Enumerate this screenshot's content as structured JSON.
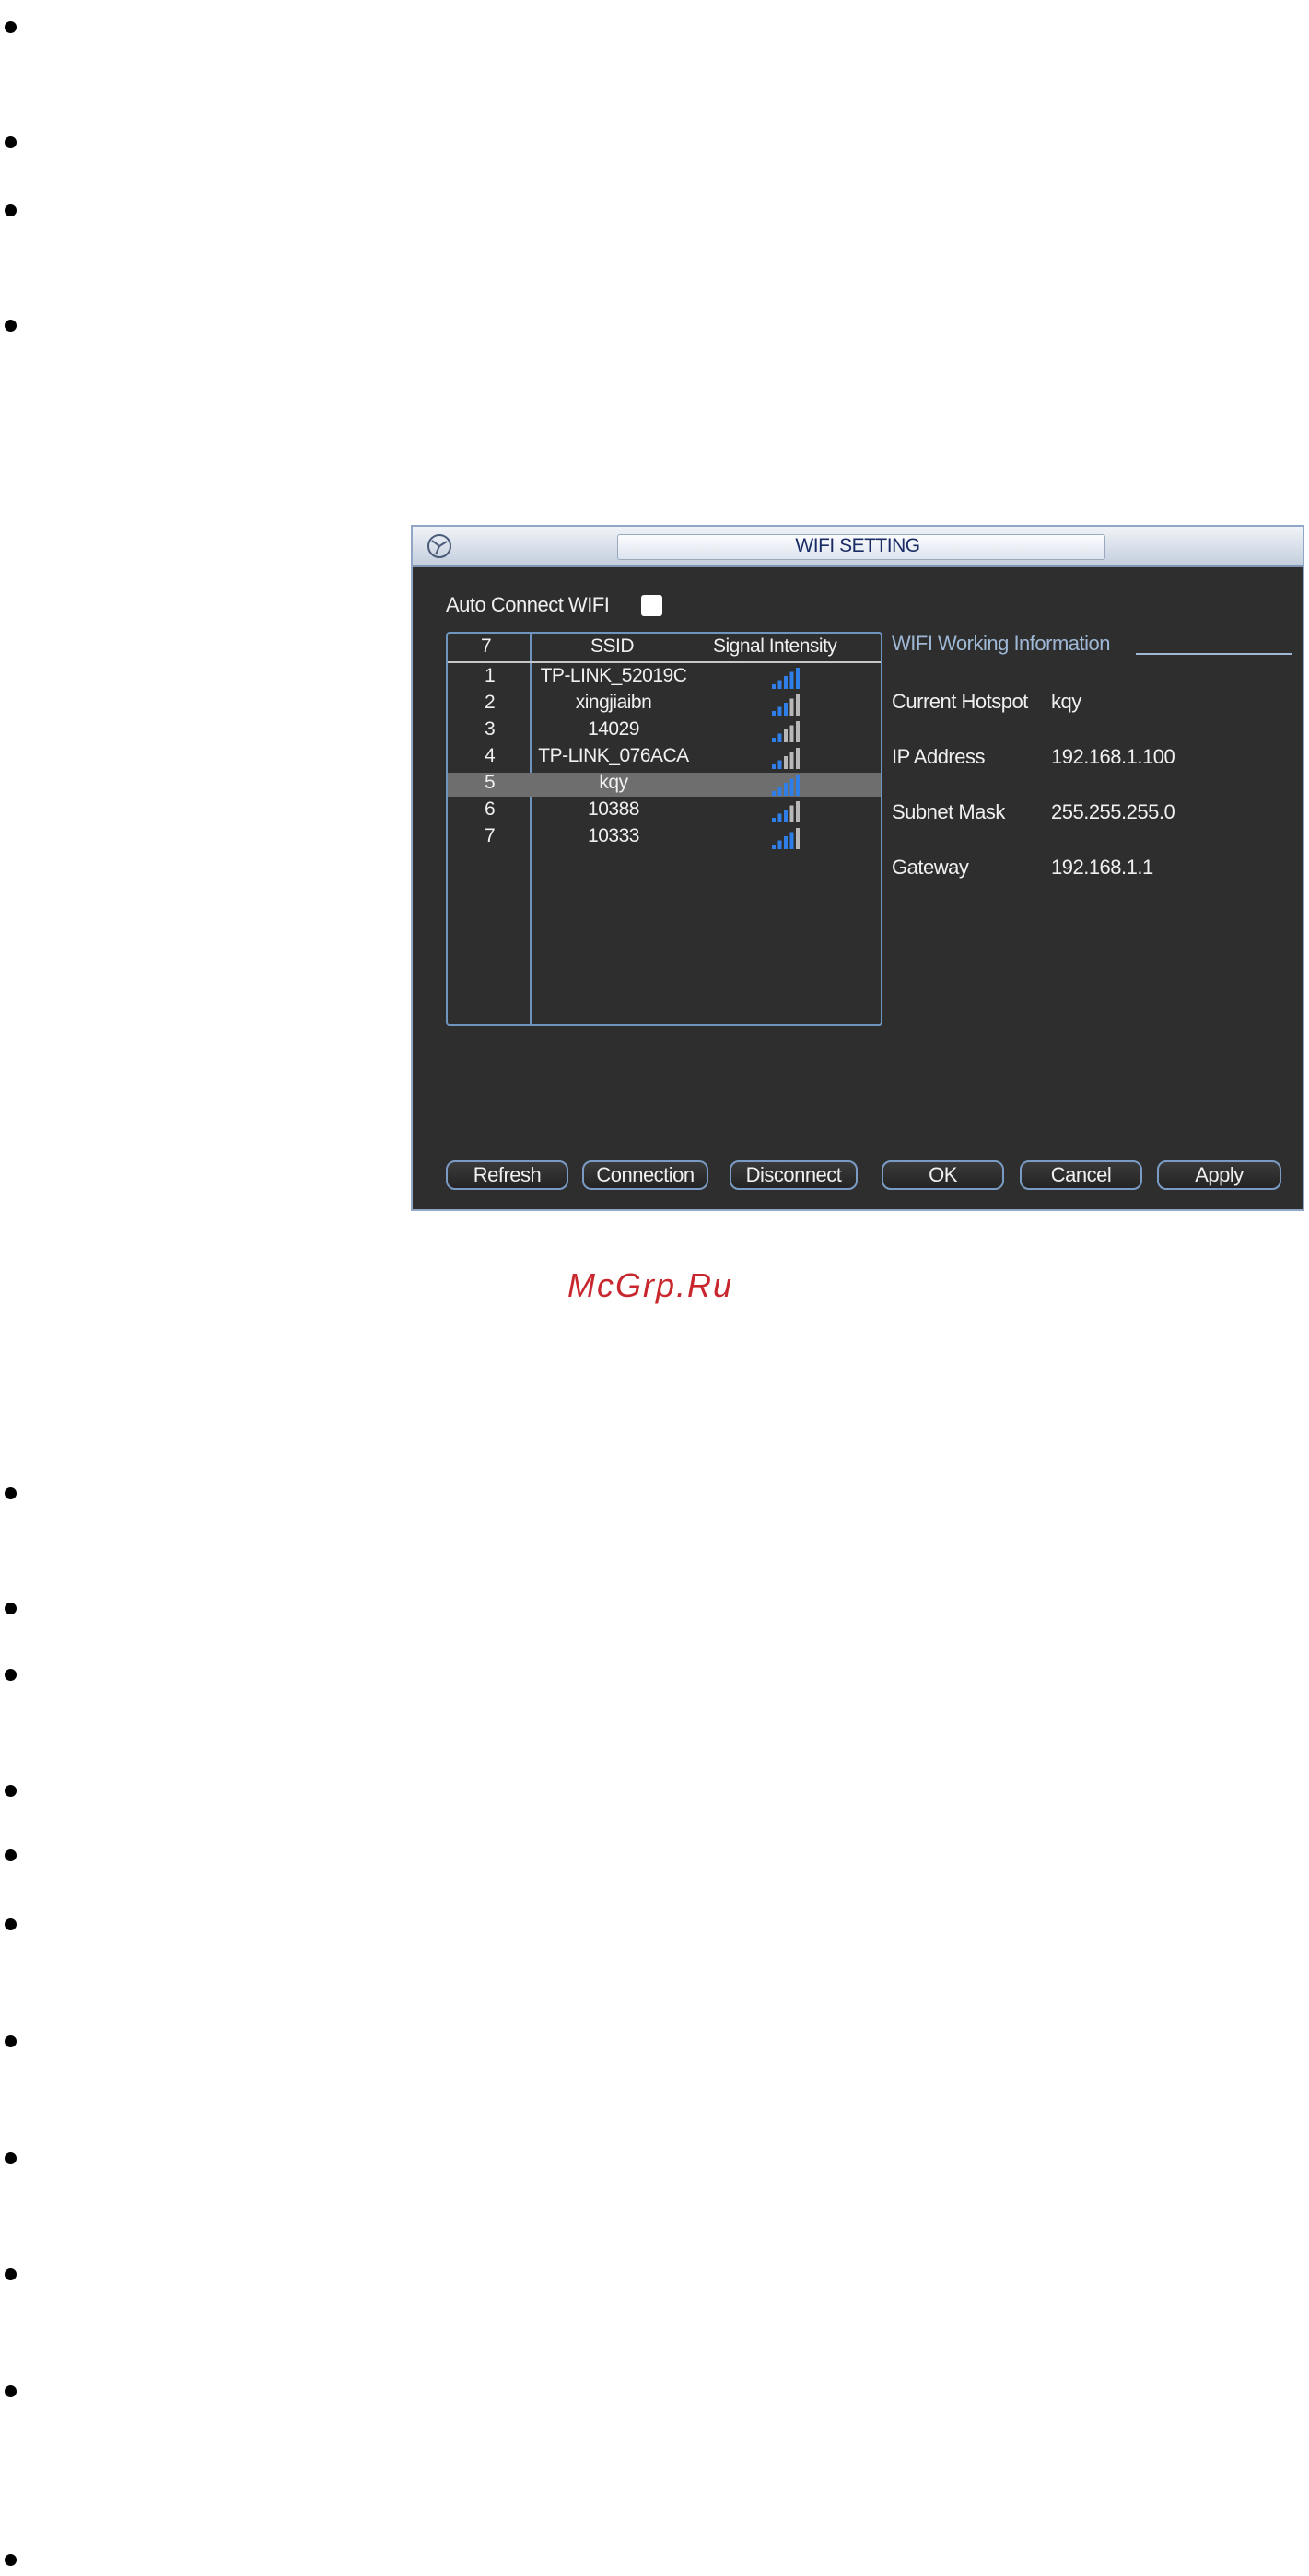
{
  "window": {
    "title": "WIFI SETTING",
    "auto_connect_label": "Auto Connect WIFI",
    "auto_connect_checked": false,
    "list": {
      "headers": {
        "count": "7",
        "ssid": "SSID",
        "signal": "Signal Intensity"
      },
      "selected_index": 4,
      "rows": [
        {
          "num": "1",
          "ssid": "TP-LINK_52019C",
          "signal_bars": 5
        },
        {
          "num": "2",
          "ssid": "xingjiaibn",
          "signal_bars": 3
        },
        {
          "num": "3",
          "ssid": "14029",
          "signal_bars": 2
        },
        {
          "num": "4",
          "ssid": "TP-LINK_076ACA",
          "signal_bars": 2
        },
        {
          "num": "5",
          "ssid": "kqy",
          "signal_bars": 5
        },
        {
          "num": "6",
          "ssid": "10388",
          "signal_bars": 3
        },
        {
          "num": "7",
          "ssid": "10333",
          "signal_bars": 4
        }
      ]
    },
    "info": {
      "title": "WIFI Working Information",
      "current_hotspot_label": "Current Hotspot",
      "current_hotspot": "kqy",
      "ip_label": "IP Address",
      "ip": "192.168.1.100",
      "mask_label": "Subnet Mask",
      "mask": "255.255.255.0",
      "gateway_label": "Gateway",
      "gateway": "192.168.1.1"
    },
    "buttons": {
      "refresh": "Refresh",
      "connection": "Connection",
      "disconnect": "Disconnect",
      "ok": "OK",
      "cancel": "Cancel",
      "apply": "Apply"
    }
  },
  "watermark": "McGrp.Ru",
  "colors": {
    "signal_on": "#2f7fe8",
    "signal_off": "#b8b8b8",
    "accent": "#6f94c0"
  }
}
